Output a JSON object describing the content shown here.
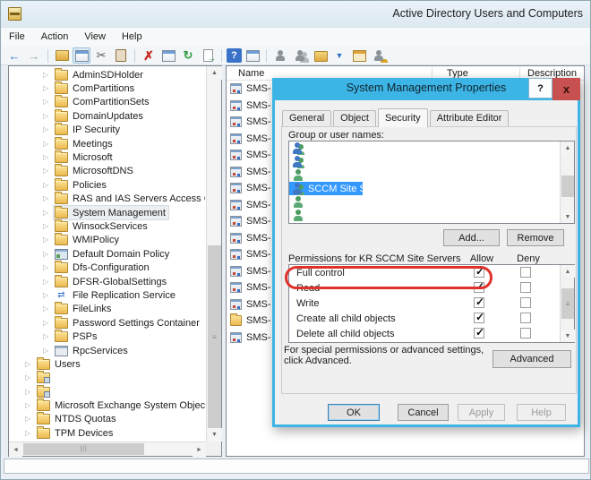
{
  "window": {
    "title": "Active Directory Users and Computers"
  },
  "menu": {
    "items": [
      {
        "label": "File",
        "name": "menu-item-file"
      },
      {
        "label": "Action",
        "name": "menu-item-action"
      },
      {
        "label": "View",
        "name": "menu-item-view"
      },
      {
        "label": "Help",
        "name": "menu-item-help"
      }
    ]
  },
  "toolbar": {
    "buttons": [
      {
        "name": "back-button",
        "icon": "back-arrow-icon",
        "glyph": "←",
        "cls": "tb-back"
      },
      {
        "name": "forward-button",
        "icon": "forward-arrow-icon",
        "glyph": "→",
        "cls": "tb-fwd"
      },
      {
        "name": "toolbar-separator",
        "cls": "sep"
      },
      {
        "name": "up-one-level-button",
        "icon": "folder-up-icon",
        "glyph": "",
        "cls": "tb-folder"
      },
      {
        "name": "show-console-tree-button",
        "icon": "console-tree-window-icon",
        "glyph": "",
        "cls": "tb-win pressed"
      },
      {
        "name": "cut-button",
        "icon": "scissors-icon",
        "glyph": "✂",
        "cls": "tb-cut"
      },
      {
        "name": "paste-button",
        "icon": "clipboard-icon",
        "glyph": "",
        "cls": "tb-paste"
      },
      {
        "name": "toolbar-separator",
        "cls": "sep"
      },
      {
        "name": "delete-button",
        "icon": "delete-x-icon",
        "glyph": "✗",
        "cls": "tb-del"
      },
      {
        "name": "properties-button",
        "icon": "properties-window-icon",
        "glyph": "",
        "cls": "tb-win2"
      },
      {
        "name": "refresh-button",
        "icon": "refresh-icon",
        "glyph": "↻",
        "cls": "tb-refresh"
      },
      {
        "name": "export-list-button",
        "icon": "export-list-icon",
        "glyph": "",
        "cls": "tb-export"
      },
      {
        "name": "toolbar-separator",
        "cls": "sep"
      },
      {
        "name": "help-button",
        "icon": "help-question-icon",
        "glyph": "?",
        "cls": "tb-help"
      },
      {
        "name": "help-topics-button",
        "icon": "window-icon",
        "glyph": "",
        "cls": "tb-win2"
      },
      {
        "name": "toolbar-separator",
        "cls": "sep"
      },
      {
        "name": "new-user-button",
        "icon": "user-icon",
        "glyph": "",
        "cls": "tb-user"
      },
      {
        "name": "new-group-button",
        "icon": "users-icon",
        "glyph": "",
        "cls": "tb-users"
      },
      {
        "name": "new-ou-button",
        "icon": "org-unit-folder-icon",
        "glyph": "",
        "cls": "tb-ou"
      },
      {
        "name": "filter-button",
        "icon": "filter-funnel-icon",
        "glyph": "▼",
        "cls": "tb-filter"
      },
      {
        "name": "change-domain-button",
        "icon": "window-orange-icon",
        "glyph": "",
        "cls": "tb-winorange"
      },
      {
        "name": "delegate-button",
        "icon": "user-key-icon",
        "glyph": "",
        "cls": "tb-userkey"
      }
    ]
  },
  "tree": {
    "items": [
      {
        "label": "AdminSDHolder",
        "cls": "lvl2 ic-folder"
      },
      {
        "label": "ComPartitions",
        "cls": "lvl2 ic-folder"
      },
      {
        "label": "ComPartitionSets",
        "cls": "lvl2 ic-folder"
      },
      {
        "label": "DomainUpdates",
        "cls": "lvl2 ic-folder"
      },
      {
        "label": "IP Security",
        "cls": "lvl2 ic-folder"
      },
      {
        "label": "Meetings",
        "cls": "lvl2 ic-folder"
      },
      {
        "label": "Microsoft",
        "cls": "lvl2 ic-folder"
      },
      {
        "label": "MicrosoftDNS",
        "cls": "lvl2 ic-folder"
      },
      {
        "label": "Policies",
        "cls": "lvl2 ic-folder"
      },
      {
        "label": "RAS and IAS Servers Access Check",
        "cls": "lvl2 ic-folder"
      },
      {
        "label": "System Management",
        "cls": "lvl2 ic-folder selected",
        "name": "tree-item-system-management"
      },
      {
        "label": "WinsockServices",
        "cls": "lvl2 ic-folder"
      },
      {
        "label": "WMIPolicy",
        "cls": "lvl2 ic-folder"
      },
      {
        "label": "Default Domain Policy",
        "cls": "lvl2 ic-gpo"
      },
      {
        "label": "Dfs-Configuration",
        "cls": "lvl2 ic-folder"
      },
      {
        "label": "DFSR-GlobalSettings",
        "cls": "lvl2 ic-folder"
      },
      {
        "label": "File Replication Service",
        "cls": "lvl2 ic-frs"
      },
      {
        "label": "FileLinks",
        "cls": "lvl2 ic-folder"
      },
      {
        "label": "Password Settings Container",
        "cls": "lvl2 ic-folder"
      },
      {
        "label": "PSPs",
        "cls": "lvl2 ic-folder"
      },
      {
        "label": "RpcServices",
        "cls": "lvl2 ic-rpc"
      },
      {
        "label": "Users",
        "cls": "lvl1 ic-folder"
      },
      {
        "label": "",
        "cls": "lvl1 ic-ou blurred bwt60",
        "name": "tree-item-redacted"
      },
      {
        "label": "",
        "cls": "lvl1 ic-ou blurred bwt75",
        "name": "tree-item-redacted"
      },
      {
        "label": "Microsoft Exchange System Objects",
        "cls": "lvl1 ic-folder"
      },
      {
        "label": "NTDS Quotas",
        "cls": "lvl1 ic-folder"
      },
      {
        "label": "TPM Devices",
        "cls": "lvl1 ic-folder"
      }
    ]
  },
  "results": {
    "columns": [
      {
        "label": "Name",
        "cls": "col-name",
        "name": "column-header-name"
      },
      {
        "label": "Type",
        "cls": "col-type",
        "name": "column-header-type"
      },
      {
        "label": "Description",
        "cls": "col-desc",
        "name": "column-header-description"
      }
    ],
    "rows": [
      {
        "label": "SMS-",
        "cls": "ic-sms"
      },
      {
        "label": "SMS-",
        "cls": "ic-sms"
      },
      {
        "label": "SMS-",
        "cls": "ic-sms"
      },
      {
        "label": "SMS-",
        "cls": "ic-sms"
      },
      {
        "label": "SMS-",
        "cls": "ic-sms"
      },
      {
        "label": "SMS-",
        "cls": "ic-sms"
      },
      {
        "label": "SMS-",
        "cls": "ic-sms"
      },
      {
        "label": "SMS-",
        "cls": "ic-sms"
      },
      {
        "label": "SMS-",
        "cls": "ic-sms"
      },
      {
        "label": "SMS-",
        "cls": "ic-sms"
      },
      {
        "label": "SMS-",
        "cls": "ic-sms"
      },
      {
        "label": "SMS-",
        "cls": "ic-sms"
      },
      {
        "label": "SMS-",
        "cls": "ic-sms"
      },
      {
        "label": "SMS-",
        "cls": "ic-sms"
      },
      {
        "label": "SMS-",
        "cls": "ic-folderitem"
      },
      {
        "label": "SMS-",
        "cls": "ic-sms"
      }
    ]
  },
  "dialog": {
    "title": "System Management Properties",
    "help_glyph": "?",
    "close_glyph": "x",
    "tabs": [
      {
        "label": "General",
        "name": "tab-general"
      },
      {
        "label": "Object",
        "name": "tab-object"
      },
      {
        "label": "Security",
        "name": "tab-security",
        "cls": "active"
      },
      {
        "label": "Attribute Editor",
        "name": "tab-attribute-editor"
      }
    ],
    "group_label": "Group or user names:",
    "group_items": [
      {
        "pre": "",
        "post": "",
        "cls": "ic-grp bw265"
      },
      {
        "pre": "",
        "post": "",
        "cls": "ic-grp bw268"
      },
      {
        "pre": "",
        "post": "",
        "cls": "ic-usr bw262"
      },
      {
        "pre": "SCCM Site Servers (",
        "post": "SCCM Site Servers)",
        "cls": "ic-grp sel bw82",
        "name": "group-item-sccm-site-servers"
      },
      {
        "pre": "",
        "post": "",
        "cls": "ic-usr bw252"
      },
      {
        "pre": "",
        "post": "",
        "cls": "ic-usr bw247"
      }
    ],
    "add_button": "Add...",
    "remove_button": "Remove",
    "permissions_label": "Permissions for KR SCCM Site Servers",
    "allow_header": "Allow",
    "deny_header": "Deny",
    "permissions": [
      {
        "label": "Full control",
        "allow": true,
        "deny": false,
        "cls": "allow-on",
        "name": "permission-row-full-control"
      },
      {
        "label": "Read",
        "allow": true,
        "deny": false,
        "cls": "allow-on",
        "name": "permission-row-read"
      },
      {
        "label": "Write",
        "allow": true,
        "deny": false,
        "cls": "allow-on",
        "name": "permission-row-write"
      },
      {
        "label": "Create all child objects",
        "allow": true,
        "deny": false,
        "cls": "allow-on",
        "name": "permission-row-create-all-child-objects"
      },
      {
        "label": "Delete all child objects",
        "allow": true,
        "deny": false,
        "cls": "allow-on",
        "name": "permission-row-delete-all-child-objects"
      }
    ],
    "advanced_note": "For special permissions or advanced settings, click Advanced.",
    "advanced_button": "Advanced",
    "ok_button": "OK",
    "cancel_button": "Cancel",
    "apply_button": "Apply",
    "help_button": "Help"
  },
  "status_bar": {
    "text": ""
  },
  "colors": {
    "dialog_accent": "#3cb5e6",
    "selection_blue": "#3399ff",
    "close_button_red": "#c75050",
    "annotation_red": "#e0312b"
  }
}
